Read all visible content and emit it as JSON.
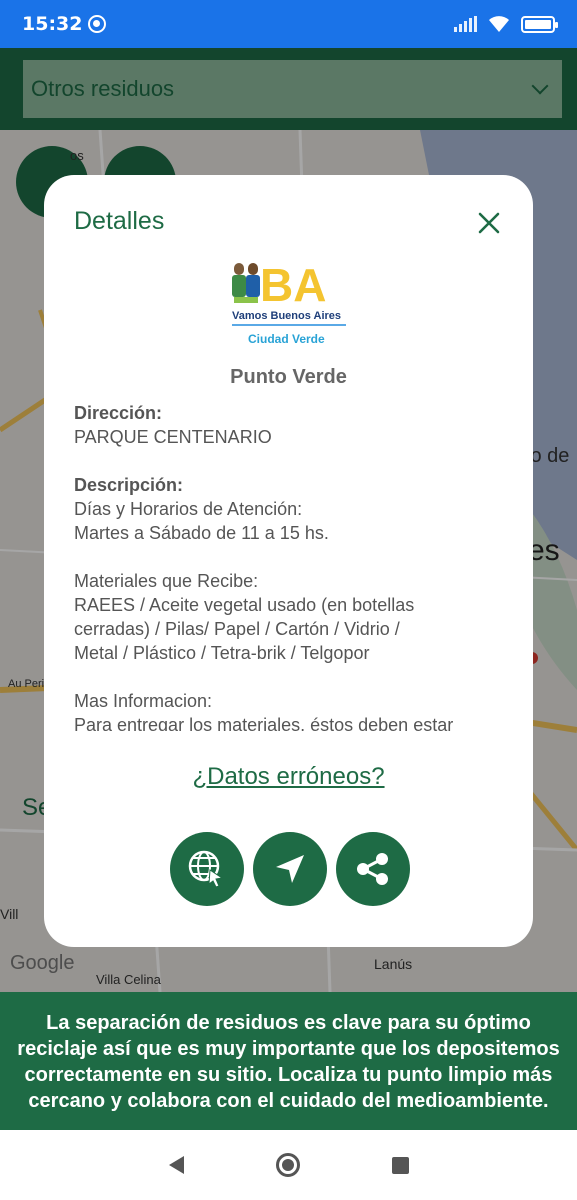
{
  "status_bar": {
    "time": "15:32"
  },
  "header": {
    "filter_label": "Otros residuos"
  },
  "map": {
    "labels": [
      "os",
      "io de",
      "es",
      "Au Perit",
      "Se",
      "Vill",
      "Google",
      "Villa Celina",
      "Lanús"
    ]
  },
  "modal": {
    "title": "Detalles",
    "logo": {
      "brand": "BA",
      "line1": "Vamos Buenos Aires",
      "line2": "Ciudad Verde"
    },
    "place_name": "Punto Verde",
    "address_heading": "Dirección:",
    "address_value": "PARQUE CENTENARIO",
    "description_heading": "Descripción:",
    "description_lines": [
      "Días y Horarios de Atención:",
      "Martes a Sábado de 11 a 15 hs."
    ],
    "materials_heading": "Materiales que Recibe:",
    "materials_lines": [
      "RAEES / Aceite vegetal usado (en botellas",
      "cerradas) / Pilas/ Papel / Cartón / Vidrio /",
      "Metal / Plástico / Tetra-brik / Telgopor"
    ],
    "more_info_heading": "Mas Informacion:",
    "more_info_line": "Para entregar los materiales, éstos deben estar",
    "report_link": "¿Datos erróneos?",
    "actions": [
      {
        "icon": "web-icon"
      },
      {
        "icon": "navigation-icon"
      },
      {
        "icon": "share-icon"
      }
    ]
  },
  "banner": {
    "text": "La separación de residuos es clave para su óptimo reciclaje así que es muy importante que los depositemos correctamente en su sitio. Localiza tu punto limpio más cercano y colabora con el cuidado del medioambiente."
  },
  "colors": {
    "primary": "#1e6b45",
    "status_bar": "#1a73e8",
    "dropdown_bg": "#8cb99b"
  }
}
